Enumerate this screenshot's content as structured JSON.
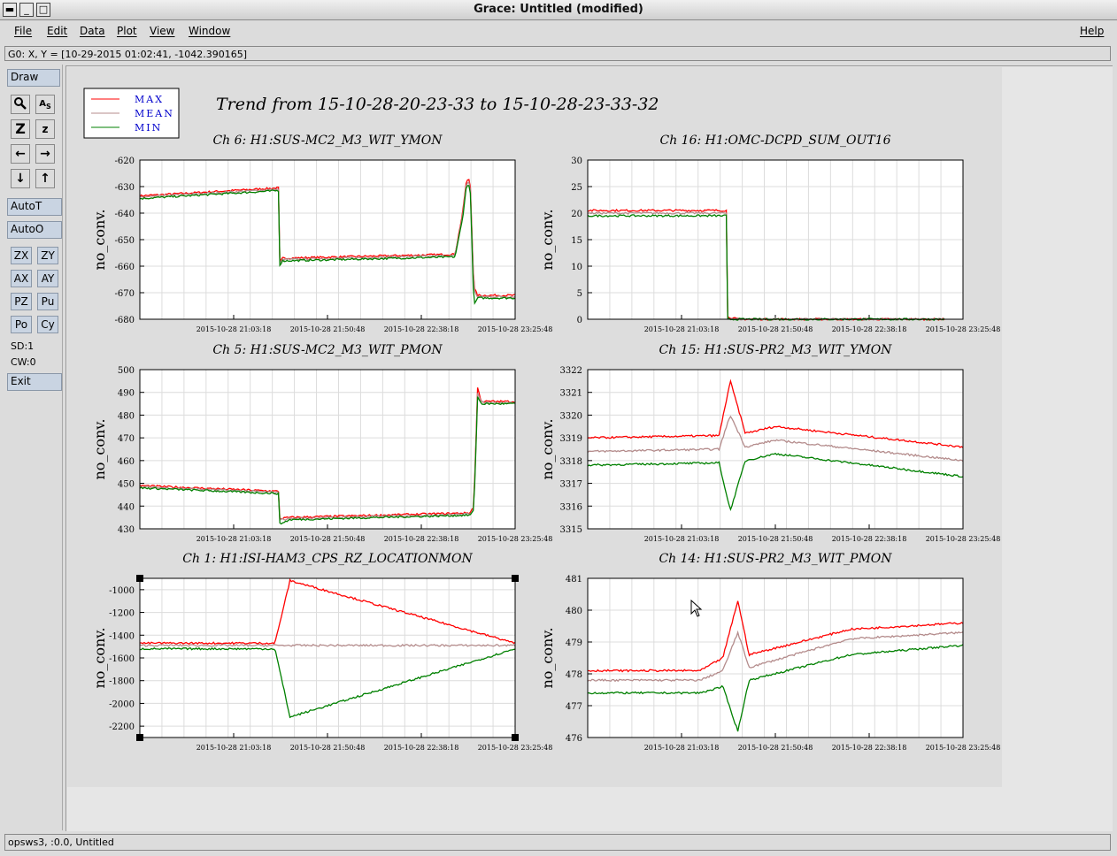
{
  "window": {
    "title": "Grace: Untitled (modified)"
  },
  "menu": {
    "items": [
      "File",
      "Edit",
      "Data",
      "Plot",
      "View",
      "Window"
    ],
    "help": "Help"
  },
  "locator": "G0: X, Y = [10-29-2015 01:02:41, -1042.390165]",
  "toolbar": {
    "draw": "Draw",
    "autot": "AutoT",
    "autoo": "AutoO",
    "small_buttons": [
      "ZX",
      "ZY",
      "AX",
      "AY",
      "PZ",
      "Pu",
      "Po",
      "Cy"
    ],
    "sd": "SD:1",
    "cw": "CW:0",
    "exit": "Exit",
    "icons": [
      "zoom-icon",
      "autoscale-text-icon",
      "zoom-z-icon",
      "zoom-z-small-icon",
      "arrow-left-icon",
      "arrow-right-icon",
      "arrow-down-icon",
      "arrow-up-icon"
    ]
  },
  "status": "opsws3, :0.0, Untitled",
  "plot": {
    "title": "Trend from 15-10-28-20-23-33 to 15-10-28-23-33-32",
    "legend": [
      "MAX",
      "MEAN",
      "MIN"
    ],
    "colors": {
      "max": "#ff0000",
      "mean": "#b48c8c",
      "min": "#008000",
      "legend_text": "#0000cc"
    },
    "x_ticks": [
      "2015-10-28 21:03:18",
      "2015-10-28 21:50:48",
      "2015-10-28 22:38:18",
      "2015-10-28 23:25:48"
    ]
  },
  "chart_data": [
    {
      "type": "line",
      "title": "Ch 6: H1:SUS-MC2_M3_WIT_YMON",
      "ylabel": "no_conv.",
      "ylim": [
        -680,
        -620
      ],
      "yticks": [
        "-620",
        "-630",
        "-640",
        "-650",
        "-660",
        "-670",
        "-680"
      ],
      "series": [
        {
          "name": "MAX",
          "x": [
            0,
            0.37,
            0.371,
            0.38,
            0.84,
            0.86,
            0.87,
            0.88,
            0.89,
            0.9,
            1.0
          ],
          "values": [
            -633.5,
            -630.5,
            -659,
            -657,
            -655.5,
            -640,
            -628,
            -627,
            -668,
            -671,
            -671
          ]
        },
        {
          "name": "MEAN",
          "x": [
            0,
            0.37,
            0.371,
            0.38,
            0.84,
            0.86,
            0.87,
            0.88,
            0.89,
            0.9,
            1.0
          ],
          "values": [
            -634,
            -631,
            -659.5,
            -657.5,
            -656,
            -641,
            -629,
            -628,
            -669,
            -671.5,
            -671.5
          ]
        },
        {
          "name": "MIN",
          "x": [
            0,
            0.37,
            0.371,
            0.38,
            0.84,
            0.86,
            0.87,
            0.88,
            0.89,
            0.9,
            1.0
          ],
          "values": [
            -634.5,
            -631.5,
            -660,
            -658,
            -656.5,
            -642,
            -630,
            -629,
            -675,
            -672,
            -672
          ]
        }
      ]
    },
    {
      "type": "line",
      "title": "Ch 16: H1:OMC-DCPD_SUM_OUT16",
      "ylabel": "no_conv.",
      "ylim": [
        0,
        30
      ],
      "yticks": [
        "30",
        "25",
        "20",
        "15",
        "10",
        "5",
        "0"
      ],
      "series": [
        {
          "name": "MAX",
          "x": [
            0,
            0.37,
            0.371,
            0.4,
            0.95
          ],
          "values": [
            20.5,
            20.5,
            0.5,
            0,
            0
          ]
        },
        {
          "name": "MEAN",
          "x": [
            0,
            0.37,
            0.371,
            0.4,
            0.95
          ],
          "values": [
            20,
            20,
            0.2,
            0,
            0
          ]
        },
        {
          "name": "MIN",
          "x": [
            0,
            0.37,
            0.371,
            0.4,
            0.95
          ],
          "values": [
            19.5,
            19.5,
            0,
            0,
            0
          ]
        }
      ]
    },
    {
      "type": "line",
      "title": "Ch 5: H1:SUS-MC2_M3_WIT_PMON",
      "ylabel": "no_conv.",
      "ylim": [
        430,
        500
      ],
      "yticks": [
        "500",
        "490",
        "480",
        "470",
        "460",
        "450",
        "440",
        "430"
      ],
      "series": [
        {
          "name": "MAX",
          "x": [
            0,
            0.37,
            0.371,
            0.4,
            0.88,
            0.89,
            0.9,
            0.91,
            1.0
          ],
          "values": [
            449,
            446.5,
            434.5,
            435,
            437,
            440,
            492,
            486,
            486
          ]
        },
        {
          "name": "MEAN",
          "x": [
            0,
            0.37,
            0.371,
            0.4,
            0.88,
            0.89,
            0.9,
            0.91,
            1.0
          ],
          "values": [
            448.5,
            446,
            434,
            434.5,
            436.5,
            439,
            490,
            485.5,
            485.5
          ]
        },
        {
          "name": "MIN",
          "x": [
            0,
            0.37,
            0.371,
            0.4,
            0.88,
            0.89,
            0.9,
            0.91,
            1.0
          ],
          "values": [
            448,
            445.5,
            432,
            434,
            436,
            438,
            488,
            485,
            485
          ]
        }
      ]
    },
    {
      "type": "line",
      "title": "Ch 15: H1:SUS-PR2_M3_WIT_YMON",
      "ylabel": "no_conv.",
      "ylim": [
        3315,
        3322
      ],
      "yticks": [
        "3322",
        "3321",
        "3320",
        "3319",
        "3318",
        "3317",
        "3316",
        "3315"
      ],
      "series": [
        {
          "name": "MAX",
          "x": [
            0,
            0.35,
            0.38,
            0.42,
            0.5,
            1.0
          ],
          "values": [
            3319,
            3319.1,
            3321.5,
            3319.2,
            3319.5,
            3318.6
          ]
        },
        {
          "name": "MEAN",
          "x": [
            0,
            0.35,
            0.38,
            0.42,
            0.5,
            1.0
          ],
          "values": [
            3318.4,
            3318.5,
            3320,
            3318.6,
            3318.9,
            3318
          ]
        },
        {
          "name": "MIN",
          "x": [
            0,
            0.35,
            0.38,
            0.42,
            0.5,
            1.0
          ],
          "values": [
            3317.8,
            3317.9,
            3315.8,
            3318,
            3318.3,
            3317.3
          ]
        }
      ]
    },
    {
      "type": "line",
      "title": "Ch 1: H1:ISI-HAM3_CPS_RZ_LOCATIONMON",
      "ylabel": "no_conv.",
      "ylim": [
        -2300,
        -900
      ],
      "yticks": [
        "-1000",
        "-1200",
        "-1400",
        "-1600",
        "-1800",
        "-2000",
        "-2200"
      ],
      "series": [
        {
          "name": "MAX",
          "x": [
            0,
            0.36,
            0.4,
            1.0
          ],
          "values": [
            -1470,
            -1470,
            -920,
            -1470
          ]
        },
        {
          "name": "MEAN",
          "x": [
            0,
            0.36,
            0.4,
            1.0
          ],
          "values": [
            -1490,
            -1490,
            -1490,
            -1490
          ]
        },
        {
          "name": "MIN",
          "x": [
            0,
            0.36,
            0.4,
            1.0
          ],
          "values": [
            -1520,
            -1520,
            -2120,
            -1520
          ]
        }
      ]
    },
    {
      "type": "line",
      "title": "Ch 14: H1:SUS-PR2_M3_WIT_PMON",
      "ylabel": "no_conv.",
      "ylim": [
        476,
        481
      ],
      "yticks": [
        "481",
        "480",
        "479",
        "478",
        "477",
        "476"
      ],
      "series": [
        {
          "name": "MAX",
          "x": [
            0,
            0.3,
            0.36,
            0.4,
            0.43,
            0.7,
            1.0
          ],
          "values": [
            478.1,
            478.1,
            478.5,
            480.3,
            478.6,
            479.4,
            479.6
          ]
        },
        {
          "name": "MEAN",
          "x": [
            0,
            0.3,
            0.36,
            0.4,
            0.43,
            0.7,
            1.0
          ],
          "values": [
            477.8,
            477.8,
            478.1,
            479.3,
            478.2,
            479.1,
            479.3
          ]
        },
        {
          "name": "MIN",
          "x": [
            0,
            0.3,
            0.36,
            0.4,
            0.43,
            0.7,
            1.0
          ],
          "values": [
            477.4,
            477.4,
            477.6,
            476.2,
            477.8,
            478.6,
            478.9
          ]
        }
      ]
    }
  ]
}
